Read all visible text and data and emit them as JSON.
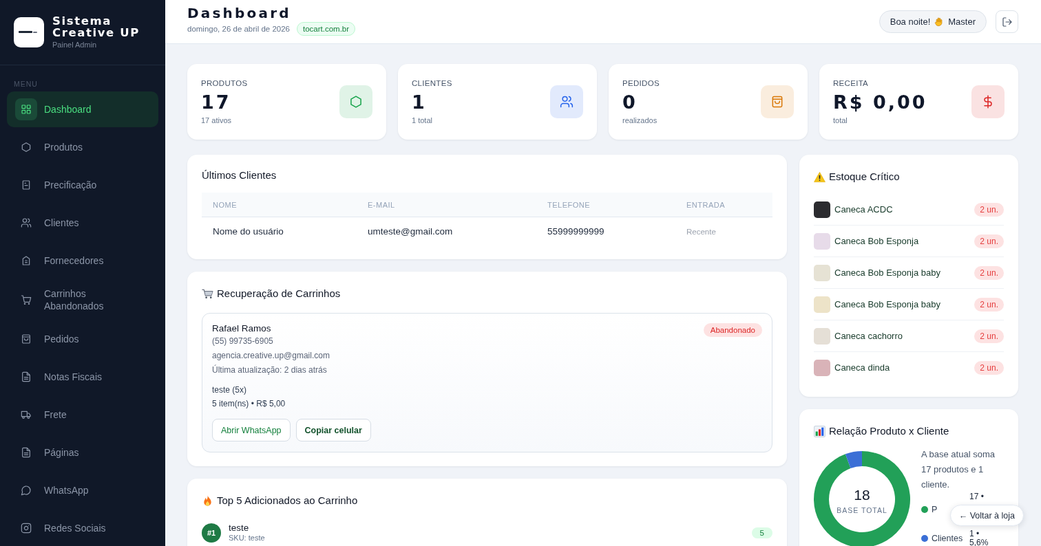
{
  "sidebar": {
    "brand": {
      "title": "Sistema Creative UP",
      "subtitle": "Painel Admin"
    },
    "section_label": "MENU",
    "items": [
      {
        "label": "Dashboard",
        "selected": true
      },
      {
        "label": "Produtos",
        "selected": false
      },
      {
        "label": "Precificação",
        "selected": false
      },
      {
        "label": "Clientes",
        "selected": false
      },
      {
        "label": "Fornecedores",
        "selected": false
      },
      {
        "label": "Carrinhos Abandonados",
        "selected": false
      },
      {
        "label": "Pedidos",
        "selected": false
      },
      {
        "label": "Notas Fiscais",
        "selected": false
      },
      {
        "label": "Frete",
        "selected": false
      },
      {
        "label": "Páginas",
        "selected": false
      },
      {
        "label": "WhatsApp",
        "selected": false
      },
      {
        "label": "Redes Sociais",
        "selected": false
      }
    ]
  },
  "header": {
    "title": "Dashboard",
    "date": "domingo, 26 de abril de 2026",
    "domain": "tocart.com.br",
    "greeting": "Boa noite!",
    "user": "Master"
  },
  "stats": [
    {
      "label": "PRODUTOS",
      "value": "17",
      "note": "17 ativos",
      "color": "#16a34a"
    },
    {
      "label": "CLIENTES",
      "value": "1",
      "note": "1 total",
      "color": "#2563eb"
    },
    {
      "label": "PEDIDOS",
      "value": "0",
      "note": "realizados",
      "color": "#d97706"
    },
    {
      "label": "RECEITA",
      "value": "R$ 0,00",
      "note": "total",
      "color": "#dc2626"
    }
  ],
  "latest_clients": {
    "title": "Últimos Clientes",
    "columns": [
      "NOME",
      "E-MAIL",
      "TELEFONE",
      "ENTRADA"
    ],
    "rows": [
      [
        "Nome do usuário",
        "umteste@gmail.com",
        "55999999999",
        "Recente"
      ]
    ]
  },
  "cart_recovery": {
    "title": "Recuperação de Carrinhos",
    "carts": [
      {
        "name": "Rafael Ramos",
        "phone": "(55) 99735-6905",
        "email": "agencia.creative.up@gmail.com",
        "updated": "Última atualização: 2 dias atrás",
        "items": "teste (5x)",
        "summary": "5 item(ns) • R$ 5,00",
        "status": "Abandonado",
        "actions": [
          "Abrir WhatsApp",
          "Copiar celular"
        ]
      }
    ]
  },
  "top_added": {
    "title": "Top 5 Adicionados ao Carrinho",
    "items": [
      {
        "rank": "#1",
        "name": "teste",
        "sku": "SKU: teste",
        "count": "5"
      }
    ]
  },
  "critical_stock": {
    "title": "Estoque Crítico",
    "items": [
      {
        "name": "Caneca ACDC",
        "stock": "2 un."
      },
      {
        "name": "Caneca Bob Esponja",
        "stock": "2 un."
      },
      {
        "name": "Caneca Bob Esponja baby",
        "stock": "2 un."
      },
      {
        "name": "Caneca Bob Esponja baby",
        "stock": "2 un."
      },
      {
        "name": "Caneca cachorro",
        "stock": "2 un."
      },
      {
        "name": "Caneca dinda",
        "stock": "2 un."
      }
    ]
  },
  "relation": {
    "title": "Relação Produto x Cliente",
    "center_value": "18",
    "center_label": "BASE TOTAL",
    "summary": "A base atual soma 17 produtos e 1 cliente.",
    "legend": [
      {
        "label": "P",
        "value": "17 •",
        "color": "#22a058"
      },
      {
        "label": "Clientes",
        "value": "1 • 5,6%",
        "color": "#3b6fd6"
      }
    ],
    "chart_data": {
      "type": "donut",
      "values": [
        94.4,
        5.6
      ]
    }
  },
  "back_button": "← Voltar à loja"
}
